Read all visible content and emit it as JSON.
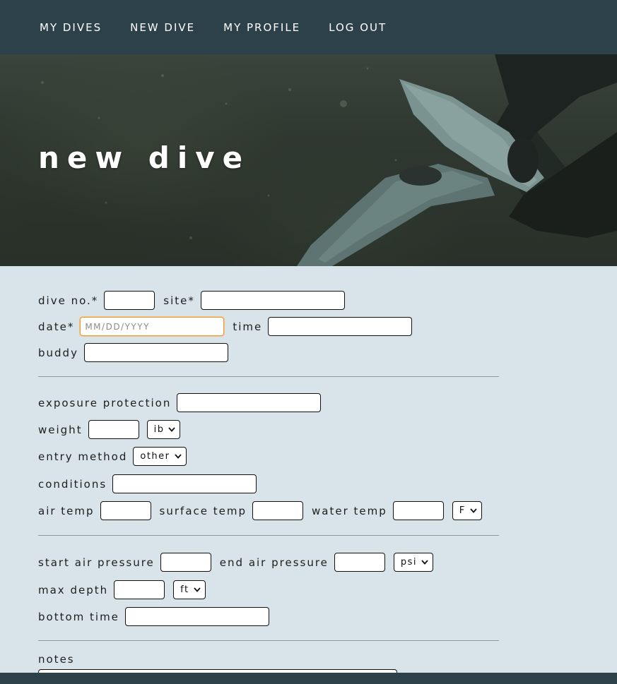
{
  "nav": {
    "items": [
      {
        "label": "MY DIVES"
      },
      {
        "label": "NEW DIVE"
      },
      {
        "label": "MY PROFILE"
      },
      {
        "label": "LOG OUT"
      }
    ]
  },
  "hero": {
    "title": "new dive"
  },
  "form": {
    "dive_no_label": "dive no.*",
    "site_label": "site*",
    "date_label": "date*",
    "date_placeholder": "MM/DD/YYYY",
    "time_label": "time",
    "buddy_label": "buddy",
    "exposure_label": "exposure protection",
    "weight_label": "weight",
    "weight_unit": "ib",
    "entry_label": "entry method",
    "entry_value": "other",
    "conditions_label": "conditions",
    "air_temp_label": "air temp",
    "surface_temp_label": "surface temp",
    "water_temp_label": "water temp",
    "temp_unit": "F",
    "start_air_label": "start air pressure",
    "end_air_label": "end air pressure",
    "pressure_unit": "psi",
    "max_depth_label": "max depth",
    "depth_unit": "ft",
    "bottom_time_label": "bottom time",
    "notes_label": "notes"
  },
  "colors": {
    "nav_bg": "#2d414b",
    "page_bg": "#d8e4ea",
    "focus_border": "#e99b3c"
  }
}
